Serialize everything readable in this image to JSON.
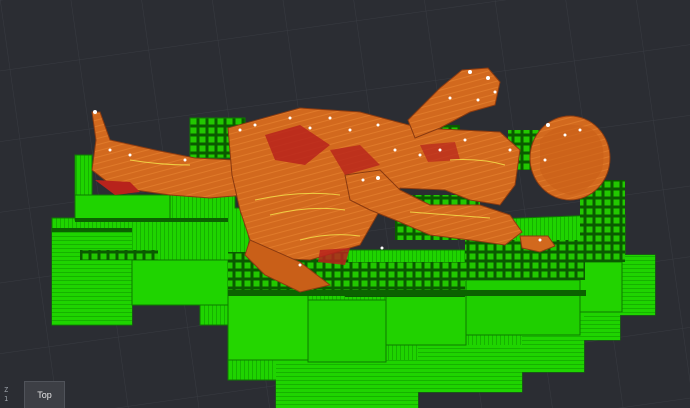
{
  "view": {
    "label": "Top",
    "axis_z": "Z",
    "axis_y": "1"
  },
  "colors": {
    "background": "#2b2d33",
    "grid": "#3a3d44",
    "support": "#1fd400",
    "support_dark": "#0c7a00",
    "model": "#d2691e",
    "model_dark": "#8a3a10",
    "infill": "#b8231c",
    "perimeter_highlight": "#f5e04a",
    "travel_marker": "#ffffff"
  },
  "icons": [
    "view-cube-icon",
    "axis-indicator-icon"
  ]
}
